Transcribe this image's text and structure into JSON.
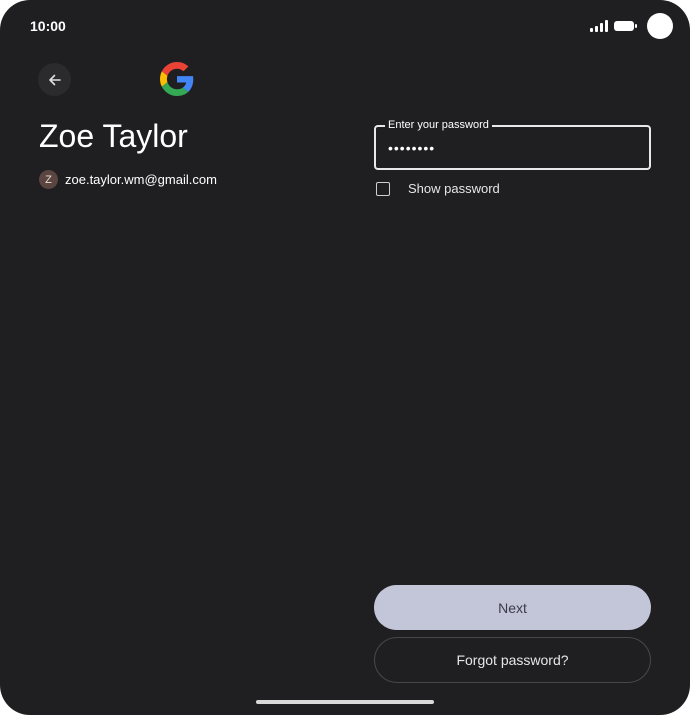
{
  "status_bar": {
    "time": "10:00",
    "icons": [
      "signal-icon",
      "battery-icon",
      "camera-cutout"
    ]
  },
  "header": {
    "back_icon": "arrow-left-icon",
    "logo": "google-g-logo",
    "logo_colors": [
      "#4285F4",
      "#EA4335",
      "#FBBC05",
      "#34A853"
    ]
  },
  "account": {
    "name": "Zoe Taylor",
    "avatar_letter": "Z",
    "email": "zoe.taylor.wm@gmail.com"
  },
  "password": {
    "label": "Enter your password",
    "value": "••••••••"
  },
  "show_password": {
    "label": "Show password",
    "checked": false
  },
  "actions": {
    "next_label": "Next",
    "forgot_label": "Forgot password?"
  },
  "colors": {
    "background": "#1f1f21",
    "primary_button": "#c3c5d9"
  }
}
